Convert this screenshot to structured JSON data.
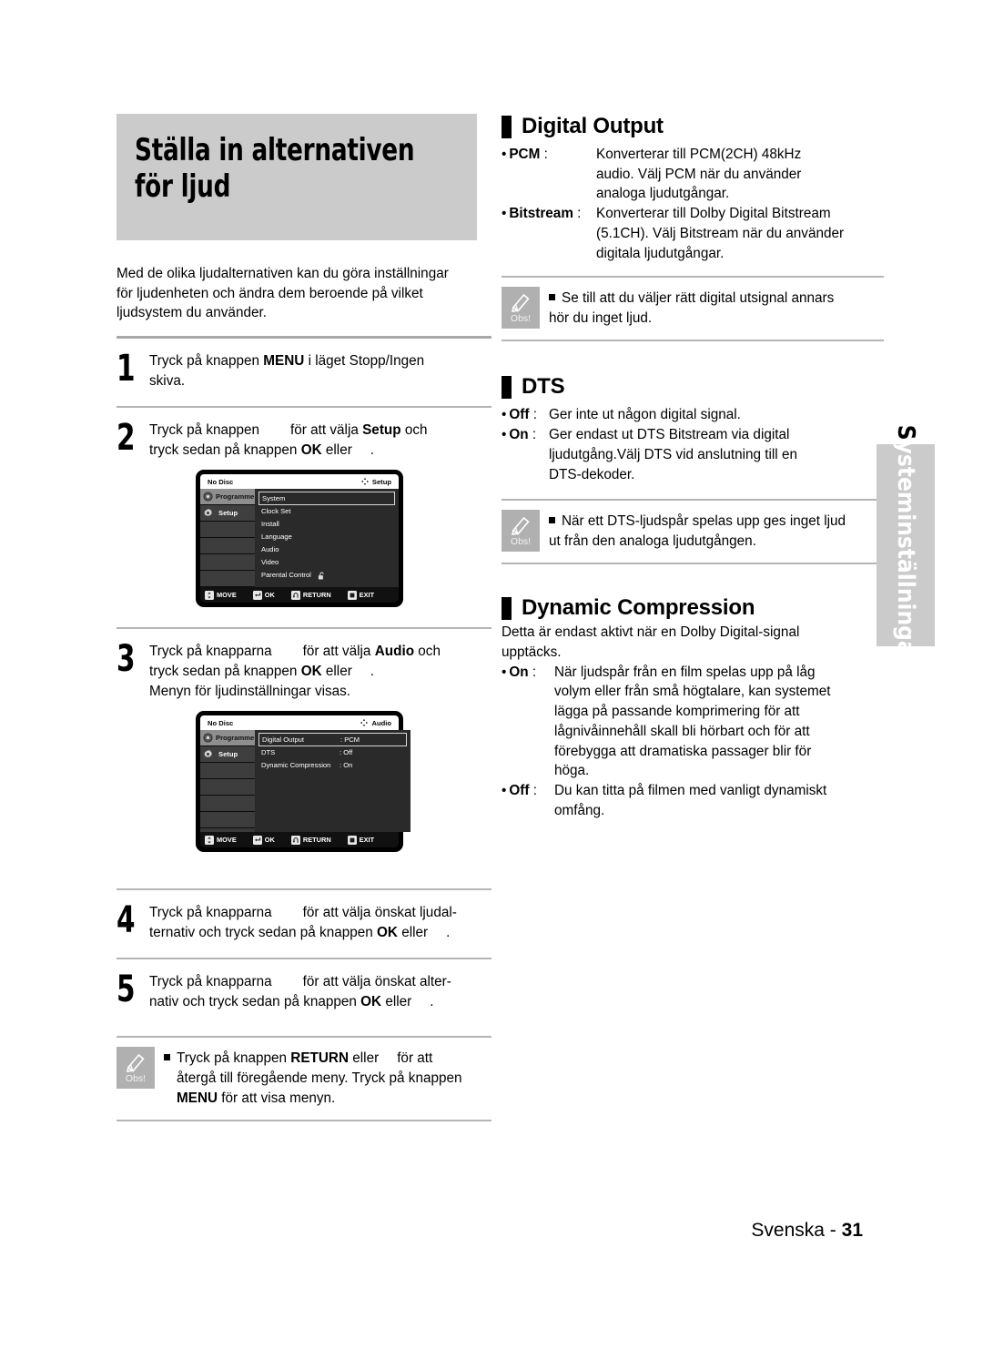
{
  "page": {
    "title_lines": "Ställa in alternativen\nför ljud",
    "intro": "Med de olika ljudalternativen kan du göra inställningar\nför ljudenheten och ändra dem beroende på vilket\nljudsystem du använder.",
    "footer_label": "Svenska - ",
    "footer_page": "31",
    "side_tab_first": "S",
    "side_tab_rest": "ysteminställningar"
  },
  "steps": [
    {
      "num": "1",
      "pre": "Tryck på knappen ",
      "bold1": "MENU",
      "mid": " i läget Stopp/Ingen",
      "line2": "skiva."
    },
    {
      "num": "2",
      "pre": "Tryck på knappen",
      "mid": "för att välja ",
      "bold1": "Setup",
      "post": " och",
      "line2_a": "tryck sedan på knappen ",
      "line2_bold": "OK",
      "line2_b": " eller",
      "line2_c": "."
    },
    {
      "num": "3",
      "pre": "Tryck på knapparna",
      "mid": "för att välja ",
      "bold1": "Audio",
      "post": " och",
      "line2_a": "tryck sedan på knappen ",
      "line2_bold": "OK",
      "line2_b": " eller",
      "line2_c": ".",
      "line3": "Menyn för ljudinställningar visas."
    },
    {
      "num": "4",
      "pre": "Tryck på knapparna",
      "mid": "för att välja önskat ljudal-",
      "line2_a": "ternativ och tryck sedan på knappen ",
      "line2_bold": "OK",
      "line2_b": " eller",
      "line2_c": "."
    },
    {
      "num": "5",
      "pre": "Tryck på knapparna",
      "mid": "för att välja önskat alter-",
      "line2_a": "nativ och tryck sedan på knappen ",
      "line2_bold": "OK",
      "line2_b": " eller",
      "line2_c": "."
    }
  ],
  "osd_setup": {
    "status": "No Disc",
    "mode": "Setup",
    "nav_icon": "four-way-arrow-icon",
    "sidebar": [
      {
        "label": "Programme",
        "icon": "programme-icon"
      },
      {
        "label": "Setup",
        "icon": "gear-icon"
      }
    ],
    "items": [
      {
        "label": "System",
        "selected": true
      },
      {
        "label": "Clock Set",
        "selected": false
      },
      {
        "label": "Install",
        "selected": false
      },
      {
        "label": "Language",
        "selected": false
      },
      {
        "label": "Audio",
        "selected": false
      },
      {
        "label": "Video",
        "selected": false
      },
      {
        "label": "Parental Control",
        "selected": false,
        "icon": "unlock-icon"
      }
    ],
    "buttons": [
      {
        "label": "MOVE",
        "icon": "updown-arrow-icon"
      },
      {
        "label": "OK",
        "icon": "enter-icon"
      },
      {
        "label": "RETURN",
        "icon": "return-arrow-icon"
      },
      {
        "label": "EXIT",
        "icon": "stop-square-icon"
      }
    ]
  },
  "osd_audio": {
    "status": "No Disc",
    "mode": "Audio",
    "nav_icon": "four-way-arrow-icon",
    "sidebar": [
      {
        "label": "Programme",
        "icon": "programme-icon"
      },
      {
        "label": "Setup",
        "icon": "gear-icon"
      }
    ],
    "items": [
      {
        "label": "Digital Output",
        "value": ": PCM",
        "selected": true
      },
      {
        "label": "DTS",
        "value": ": Off",
        "selected": false
      },
      {
        "label": "Dynamic Compression",
        "value": ": On",
        "selected": false
      }
    ],
    "buttons": [
      {
        "label": "MOVE",
        "icon": "updown-arrow-icon"
      },
      {
        "label": "OK",
        "icon": "enter-icon"
      },
      {
        "label": "RETURN",
        "icon": "return-arrow-icon"
      },
      {
        "label": "EXIT",
        "icon": "stop-square-icon"
      }
    ]
  },
  "note_left": {
    "badge": "Obs!",
    "line1_a": "Tryck på knappen ",
    "line1_bold": "RETURN",
    "line1_b": " eller",
    "line1_c": "för att",
    "line2": "återgå till föregående meny. Tryck på knappen",
    "line3_bold": "MENU",
    "line3_rest": " för att visa menyn."
  },
  "sections": [
    {
      "id": "digital-output",
      "title": "Digital Output",
      "rows": [
        {
          "term_dot": "•",
          "term_bold": "PCM",
          "term_tail": " :",
          "desc": "Konverterar till PCM(2CH) 48kHz\naudio. Välj PCM när du använder\nanaloga ljudutgångar."
        },
        {
          "term_dot": "•",
          "term_bold": "Bitstream",
          "term_tail": " :",
          "desc": "Konverterar till Dolby Digital Bitstream\n(5.1CH). Välj Bitstream när du använder\ndigitala ljudutgångar."
        }
      ],
      "note": {
        "badge": "Obs!",
        "text": "Se till att du väljer rätt digital utsignal annars\nhör du inget ljud."
      }
    },
    {
      "id": "dts",
      "title": "DTS",
      "rows": [
        {
          "term_dot": "•",
          "term_bold": "Off",
          "term_tail": " :",
          "desc": "Ger inte ut någon digital signal."
        },
        {
          "term_dot": "•",
          "term_bold": "On",
          "term_tail": " :",
          "desc": "Ger endast ut DTS Bitstream via digital\nljudutgång.Välj DTS vid anslutning till en\nDTS-dekoder."
        }
      ],
      "note": {
        "badge": "Obs!",
        "text": "När ett DTS-ljudspår spelas upp ges inget ljud\nut från den analoga ljudutgången."
      }
    },
    {
      "id": "dynamic-compression",
      "title": "Dynamic Compression",
      "lead": "Detta är endast aktivt när en Dolby Digital-signal\nupptäcks.",
      "rows": [
        {
          "term_dot": "•",
          "term_bold": "On",
          "term_tail": " :",
          "desc": "När ljudspår från en film spelas upp på låg\nvolym eller från små högtalare, kan systemet\nlägga på passande komprimering för att\nlågnivåinnehåll skall bli hörbart och för att\nförebygga att dramatiska passager blir för\nhöga."
        },
        {
          "term_dot": "•",
          "term_bold": "Off",
          "term_tail": " :",
          "desc": "Du kan titta på filmen med vanligt dynamiskt\nomfång."
        }
      ]
    }
  ]
}
